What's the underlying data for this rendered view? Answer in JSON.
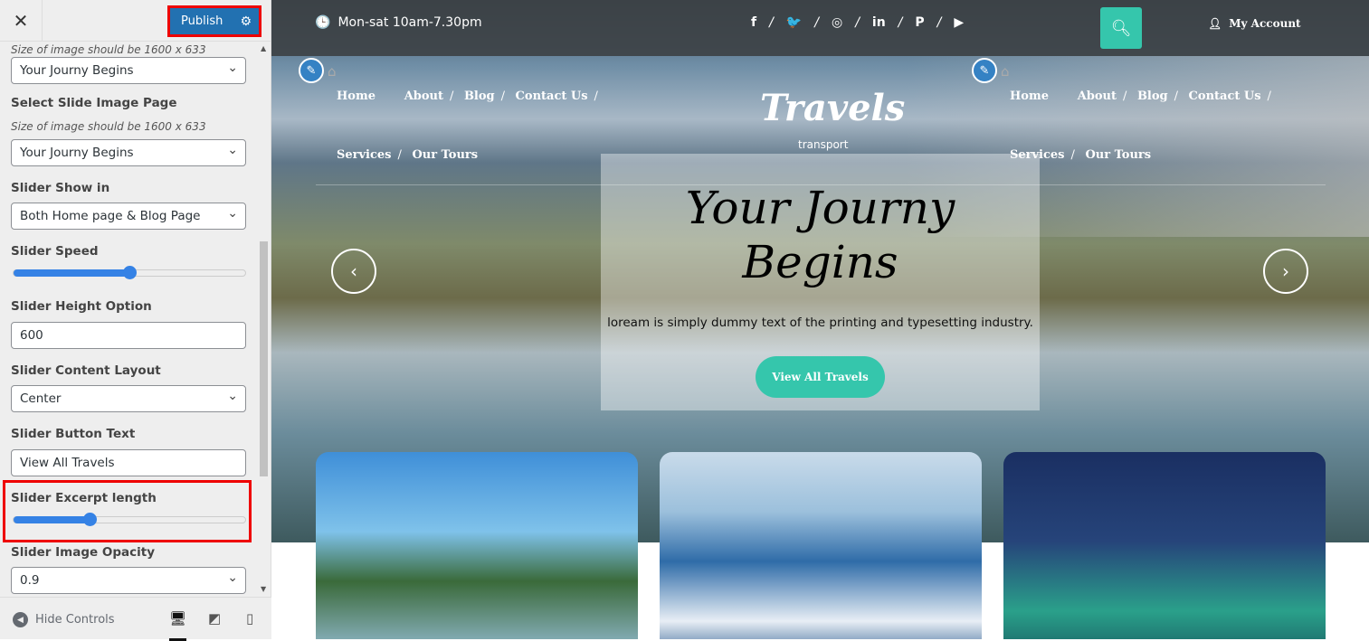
{
  "customizer": {
    "close_label": "✕",
    "publish_label": "Publish",
    "controls": {
      "prev_desc": "Size of image should be 1600 x 633",
      "prev_select": "Your Journy Begins",
      "slide_image_label": "Select Slide Image Page",
      "slide_image_desc": "Size of image should be 1600 x 633",
      "slide_image_value": "Your Journy Begins",
      "show_in_label": "Slider Show in",
      "show_in_value": "Both Home page & Blog Page",
      "speed_label": "Slider Speed",
      "speed_value_pct": 50,
      "height_label": "Slider Height Option",
      "height_value": "600",
      "layout_label": "Slider Content Layout",
      "layout_value": "Center",
      "button_text_label": "Slider Button Text",
      "button_text_value": "View All Travels",
      "excerpt_label": "Slider Excerpt length",
      "excerpt_value_pct": 33,
      "opacity_label": "Slider Image Opacity",
      "opacity_value": "0.9"
    },
    "footer": {
      "hide_controls": "Hide Controls"
    }
  },
  "site": {
    "hours": "Mon-sat 10am-7.30pm",
    "social": [
      "f",
      "t",
      "ig",
      "in",
      "p",
      "yt"
    ],
    "account": "My Account",
    "nav": {
      "home": "Home",
      "about": "About",
      "blog": "Blog",
      "contact": "Contact Us",
      "services": "Services",
      "tours": "Our Tours"
    },
    "logo": "Travels",
    "tagline": "transport",
    "slide": {
      "title": "Your Journy Begins",
      "text": "loream is simply dummy text of the printing and typesetting industry.",
      "button": "View All Travels"
    },
    "accent": "#35c6ac"
  }
}
